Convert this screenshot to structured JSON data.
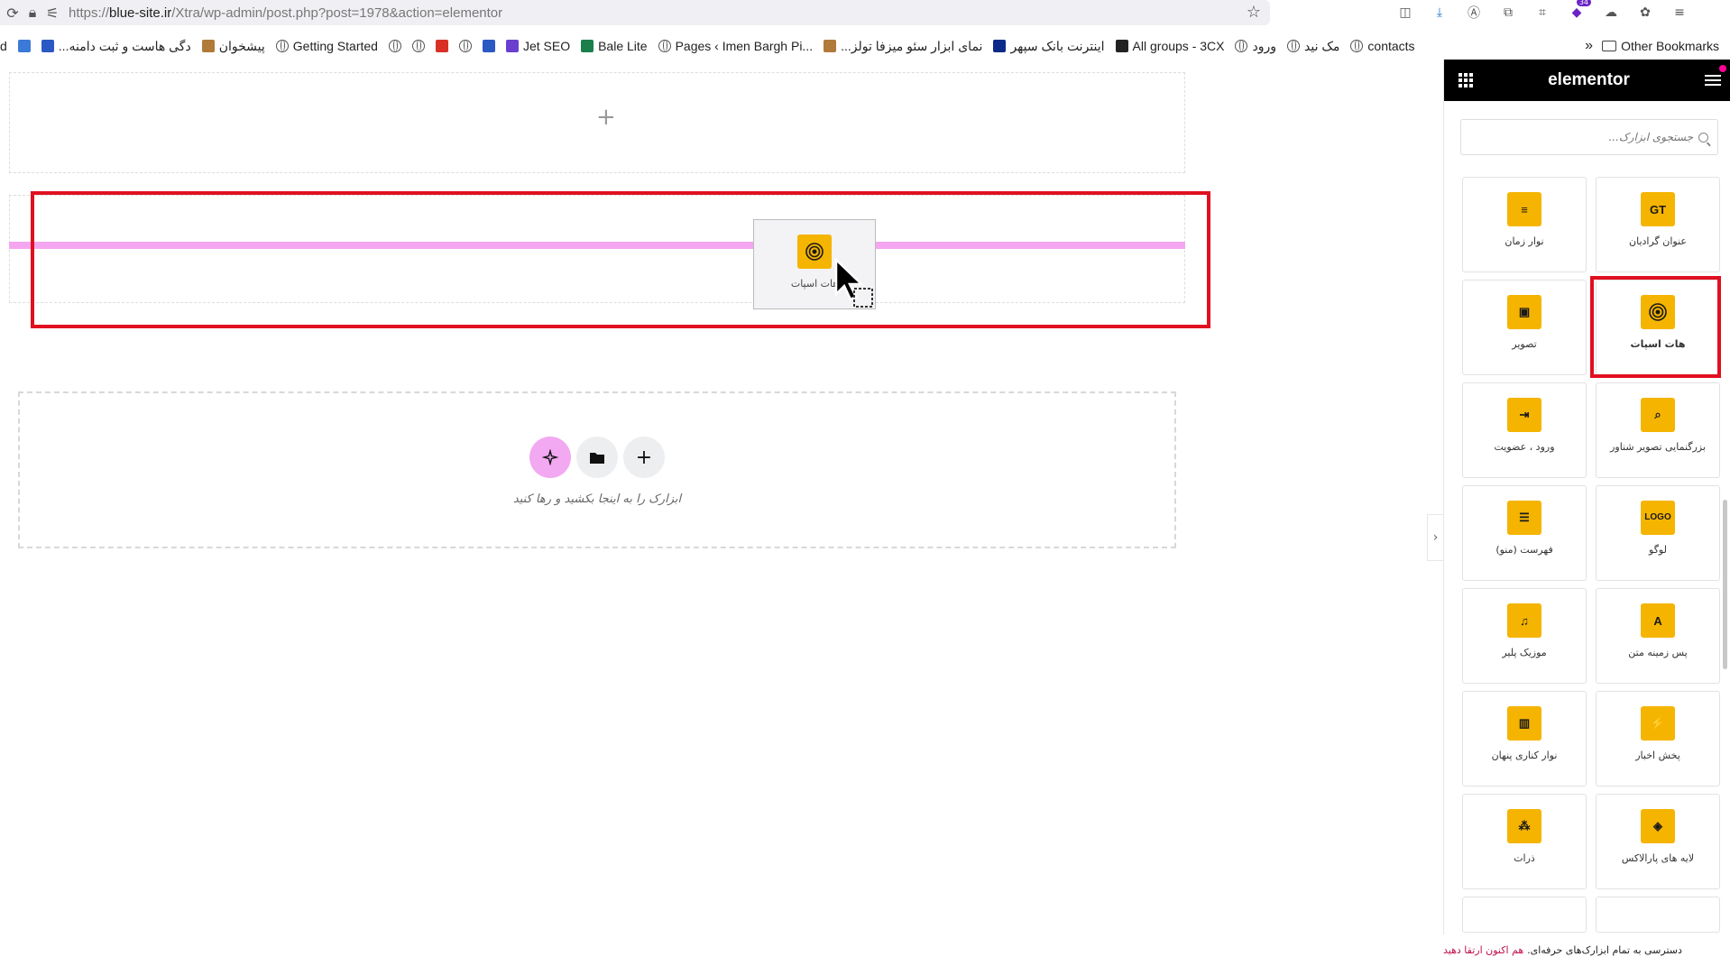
{
  "browser": {
    "url_prefix": "https://",
    "url_host": "blue-site.ir",
    "url_path": "/Xtra/wp-admin/post.php?post=1978&action=elementor",
    "download_badge": "34"
  },
  "bookmarks": [
    {
      "label": "d",
      "icon": "none"
    },
    {
      "label": "",
      "icon": "save-icon"
    },
    {
      "label": "...دگی هاست و ثبت دامنه",
      "icon": "arrow-icon"
    },
    {
      "label": "پیشخوان",
      "icon": "wp-icon"
    },
    {
      "label": "Getting Started",
      "icon": "globe-icon"
    },
    {
      "label": "",
      "icon": "globe-icon"
    },
    {
      "label": "",
      "icon": "globe-icon"
    },
    {
      "label": "",
      "icon": "gmail-icon"
    },
    {
      "label": "",
      "icon": "globe-icon"
    },
    {
      "label": "",
      "icon": "plugin-icon"
    },
    {
      "label": "Jet SEO",
      "icon": "rocket-icon"
    },
    {
      "label": "Bale Lite",
      "icon": "bale-icon"
    },
    {
      "label": "Pages ‹ Imen Bargh Pi...",
      "icon": "globe-icon"
    },
    {
      "label": "...نمای ابزار سئو میزفا تولز",
      "icon": "wp-icon"
    },
    {
      "label": "اینترنت بانک سپهر",
      "icon": "bank-icon"
    },
    {
      "label": "All groups - 3CX",
      "icon": "3cx-icon"
    },
    {
      "label": "ورود",
      "icon": "globe-icon"
    },
    {
      "label": "مک نید",
      "icon": "globe-icon"
    },
    {
      "label": "contacts",
      "icon": "globe-icon"
    }
  ],
  "bookmarks_more": "»",
  "other_bookmarks": "Other Bookmarks",
  "canvas": {
    "add_plus": "+",
    "dragging_widget_label": "هات اسپات",
    "drop_hint": "ابزارک را به اینجا بکشید و رها کنید",
    "collapse_arrow": "›"
  },
  "panel": {
    "brand": "elementor",
    "search_placeholder": "جستجوی ابزارک...",
    "widgets": [
      {
        "label": "عنوان گرادیان",
        "icon": "gradient-title-icon",
        "glyph": "GT"
      },
      {
        "label": "نوار زمان",
        "icon": "timeline-icon",
        "glyph": "≡"
      },
      {
        "label": "هات اسپات",
        "icon": "hotspot-icon",
        "glyph": "◉",
        "selected": true
      },
      {
        "label": "تصویر",
        "icon": "image-icon",
        "glyph": "▣"
      },
      {
        "label": "بزرگنمایی تصویر شناور",
        "icon": "image-zoom-icon",
        "glyph": "⌕"
      },
      {
        "label": "ورود ، عضویت",
        "icon": "login-icon",
        "glyph": "⇥"
      },
      {
        "label": "لوگو",
        "icon": "logo-icon",
        "glyph": "LOGO"
      },
      {
        "label": "فهرست (منو)",
        "icon": "menu-icon",
        "glyph": "☰"
      },
      {
        "label": "پس زمینه متن",
        "icon": "text-background-icon",
        "glyph": "A"
      },
      {
        "label": "موزیک پلیر",
        "icon": "music-icon",
        "glyph": "♫"
      },
      {
        "label": "پخش اخبار",
        "icon": "news-ticker-icon",
        "glyph": "⚡"
      },
      {
        "label": "نوار کناری پنهان",
        "icon": "off-canvas-icon",
        "glyph": "▥"
      },
      {
        "label": "لایه های پارالاکس",
        "icon": "parallax-icon",
        "glyph": "◈"
      },
      {
        "label": "ذرات",
        "icon": "particles-icon",
        "glyph": "⁂"
      }
    ],
    "promo_text": "دسترسی به تمام ابزارک‌های حرفه‌ای.",
    "promo_link": "هم اکنون ارتقا دهید"
  },
  "colors": {
    "accent_yellow": "#f5b400",
    "highlight_red": "#e01020",
    "drop_line_pink": "#f4a6f0",
    "promo_link": "#c0114c"
  }
}
